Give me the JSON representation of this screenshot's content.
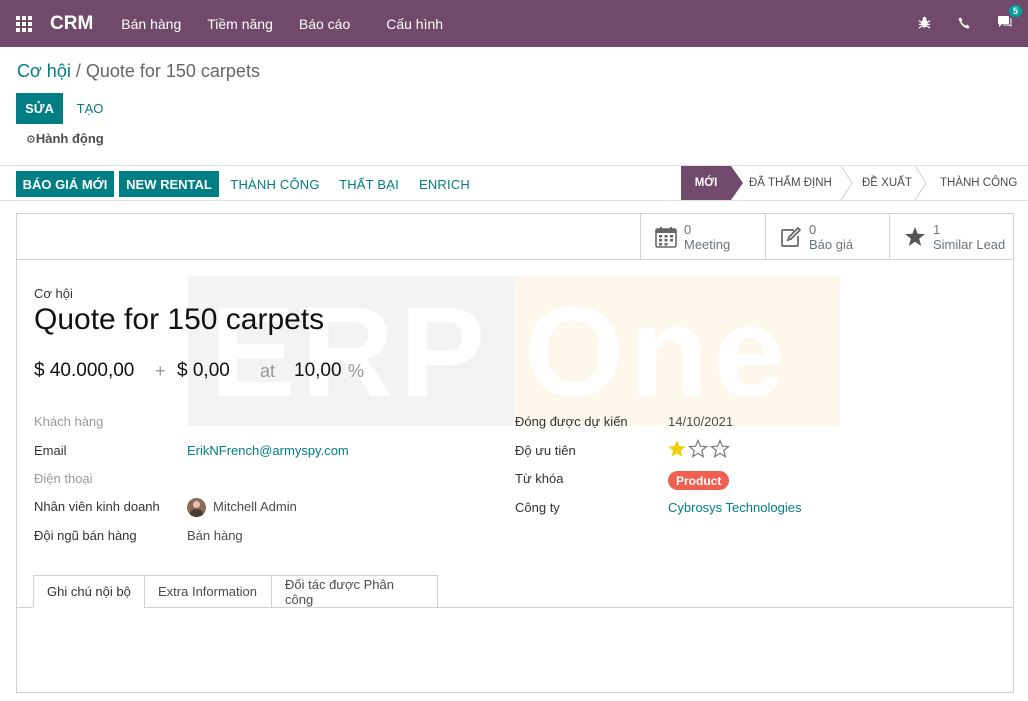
{
  "navbar": {
    "brand": "CRM",
    "menu": [
      "Bán hàng",
      "Tiềm năng",
      "Báo cáo",
      "Cấu hình"
    ],
    "chat_badge": "5"
  },
  "breadcrumb": {
    "parent": "Cơ hội",
    "separator": " / ",
    "current": "Quote for 150 carpets"
  },
  "control": {
    "edit_label": "SỬA",
    "create_label": "TẠO",
    "action_label": "Hành động"
  },
  "header_buttons": [
    "BÁO GIÁ MỚI",
    "NEW RENTAL",
    "THÀNH CÔNG",
    "THẤT BẠI",
    "ENRICH"
  ],
  "stages": {
    "items": [
      "MỚI",
      "ĐÃ THẨM ĐỊNH",
      "ĐỀ XUẤT",
      "THÀNH CÔNG"
    ],
    "active": "MỚI"
  },
  "smart_buttons": [
    {
      "count": "0",
      "label": "Meeting",
      "icon": "calendar-icon"
    },
    {
      "count": "0",
      "label": "Báo giá",
      "icon": "edit-icon"
    },
    {
      "count": "1",
      "label": "Similar Lead",
      "icon": "star-icon"
    }
  ],
  "watermark": {
    "left": "ERP",
    "right": "One"
  },
  "form": {
    "record_label": "Cơ hội",
    "title": "Quote for 150 carpets",
    "expected_revenue": "$ 40.000,00",
    "plus": "+",
    "recurring_revenue": "$ 0,00",
    "at": "at",
    "probability": "10,00",
    "percent": "%",
    "left_fields": [
      {
        "label": "Khách hàng",
        "value": ""
      },
      {
        "label": "Email",
        "value": "ErikNFrench@armyspy.com"
      },
      {
        "label": "Điện thoại",
        "value": ""
      },
      {
        "label": "Nhân viên kinh doanh",
        "value": "Mitchell Admin"
      },
      {
        "label": "Đội ngũ bán hàng",
        "value": "Bán hàng"
      }
    ],
    "right_fields": [
      {
        "label": "Đóng được dự kiến",
        "value": "14/10/2021"
      },
      {
        "label": "Độ ưu tiên",
        "value": ""
      },
      {
        "label": "Từ khóa",
        "value": "Product"
      },
      {
        "label": "Công ty",
        "value": "Cybrosys Technologies"
      }
    ],
    "priority": {
      "stars_filled": 1,
      "stars_total": 3
    },
    "tag_color": "#f06050"
  },
  "tabs": [
    "Ghi chú nội bộ",
    "Extra Information",
    "Đối tác được Phân công"
  ],
  "colors": {
    "navbar": "#71496a",
    "primary": "#017e84",
    "star": "#f3cc00"
  }
}
